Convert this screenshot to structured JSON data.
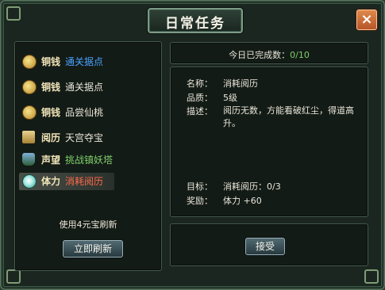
{
  "window": {
    "title": "日常任务",
    "close_label": "×"
  },
  "tasks": [
    {
      "tag": "铜钱",
      "name": "通关据点",
      "icon": "coin-icon",
      "name_color": "#4aa2ff"
    },
    {
      "tag": "铜钱",
      "name": "通关据点",
      "icon": "coin-icon",
      "name_color": "#e9e6d8"
    },
    {
      "tag": "铜钱",
      "name": "品尝仙桃",
      "icon": "coin-icon",
      "name_color": "#e9e6d8"
    },
    {
      "tag": "阅历",
      "name": "天宫夺宝",
      "icon": "scroll-icon",
      "name_color": "#e9e6d8"
    },
    {
      "tag": "声望",
      "name": "挑战镇妖塔",
      "icon": "figure-icon",
      "name_color": "#7fcf6a"
    },
    {
      "tag": "体力",
      "name": "消耗阅历",
      "icon": "orb-icon",
      "name_color": "#ff6a4a",
      "selected": true
    }
  ],
  "refresh": {
    "text": "使用4元宝刷新",
    "button": "立即刷新"
  },
  "progress": {
    "label": "今日已完成数：",
    "value": "0/10"
  },
  "detail": {
    "name_label": "名称：",
    "name": "消耗阅历",
    "quality_label": "品质：",
    "quality": "5级",
    "desc_label": "描述：",
    "desc": "阅历无数，方能看破红尘，得道高升。",
    "goal_label": "目标：",
    "goal": "消耗阅历：0/3",
    "reward_label": "奖励：",
    "reward": "体力 +60"
  },
  "accept_button": "接受"
}
